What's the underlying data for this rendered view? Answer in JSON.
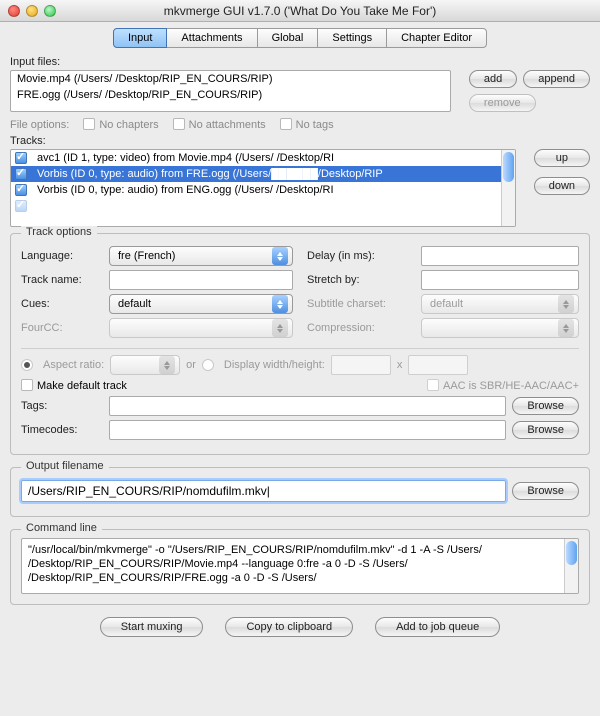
{
  "window": {
    "title": "mkvmerge GUI v1.7.0 ('What Do You Take Me For')"
  },
  "tabs": {
    "input": "Input",
    "attachments": "Attachments",
    "global": "Global",
    "settings": "Settings",
    "chapter": "Chapter Editor"
  },
  "labels": {
    "input_files": "Input files:",
    "file_options": "File options:",
    "no_chapters": "No chapters",
    "no_attachments": "No attachments",
    "no_tags": "No tags",
    "tracks": "Tracks:",
    "track_options": "Track options",
    "language": "Language:",
    "track_name": "Track name:",
    "cues": "Cues:",
    "fourcc": "FourCC:",
    "delay": "Delay (in ms):",
    "stretch": "Stretch by:",
    "sub_charset": "Subtitle charset:",
    "compression": "Compression:",
    "aspect": "Aspect ratio:",
    "or": "or",
    "dwh": "Display width/height:",
    "x": "x",
    "make_default": "Make default track",
    "aac_sbr": "AAC is SBR/HE-AAC/AAC+",
    "tags": "Tags:",
    "timecodes": "Timecodes:",
    "output_filename": "Output filename",
    "command_line": "Command line"
  },
  "buttons": {
    "add": "add",
    "append": "append",
    "remove": "remove",
    "up": "up",
    "down": "down",
    "browse": "Browse",
    "start_muxing": "Start muxing",
    "copy_clip": "Copy to clipboard",
    "add_queue": "Add to job queue"
  },
  "input_files": [
    "Movie.mp4 (/Users/          /Desktop/RIP_EN_COURS/RIP)",
    "FRE.ogg (/Users/          /Desktop/RIP_EN_COURS/RIP)"
  ],
  "tracks": [
    {
      "checked": true,
      "selected": false,
      "text": "avc1 (ID 1, type: video) from Movie.mp4 (/Users/          /Desktop/RI"
    },
    {
      "checked": true,
      "selected": true,
      "text": "Vorbis (ID 0, type: audio) from FRE.ogg (/Users/██████/Desktop/RIP"
    },
    {
      "checked": true,
      "selected": false,
      "text": "Vorbis (ID 0, type: audio) from ENG.ogg (/Users/          /Desktop/RI"
    }
  ],
  "track_options": {
    "language": "fre (French)",
    "track_name": "",
    "cues": "default",
    "fourcc": "",
    "delay": "",
    "stretch": "",
    "sub_charset": "default",
    "compression": "",
    "aspect": "",
    "width": "",
    "height": "",
    "tags": "",
    "timecodes": ""
  },
  "output_filename": "/Users/RIP_EN_COURS/RIP/nomdufilm.mkv|",
  "command_line": "\"/usr/local/bin/mkvmerge\" -o \"/Users/RIP_EN_COURS/RIP/nomdufilm.mkv\"  -d 1 -A -S /Users/          /Desktop/RIP_EN_COURS/RIP/Movie.mp4 --language 0:fre -a 0 -D -S /Users/          /Desktop/RIP_EN_COURS/RIP/FRE.ogg -a 0 -D -S /Users/"
}
